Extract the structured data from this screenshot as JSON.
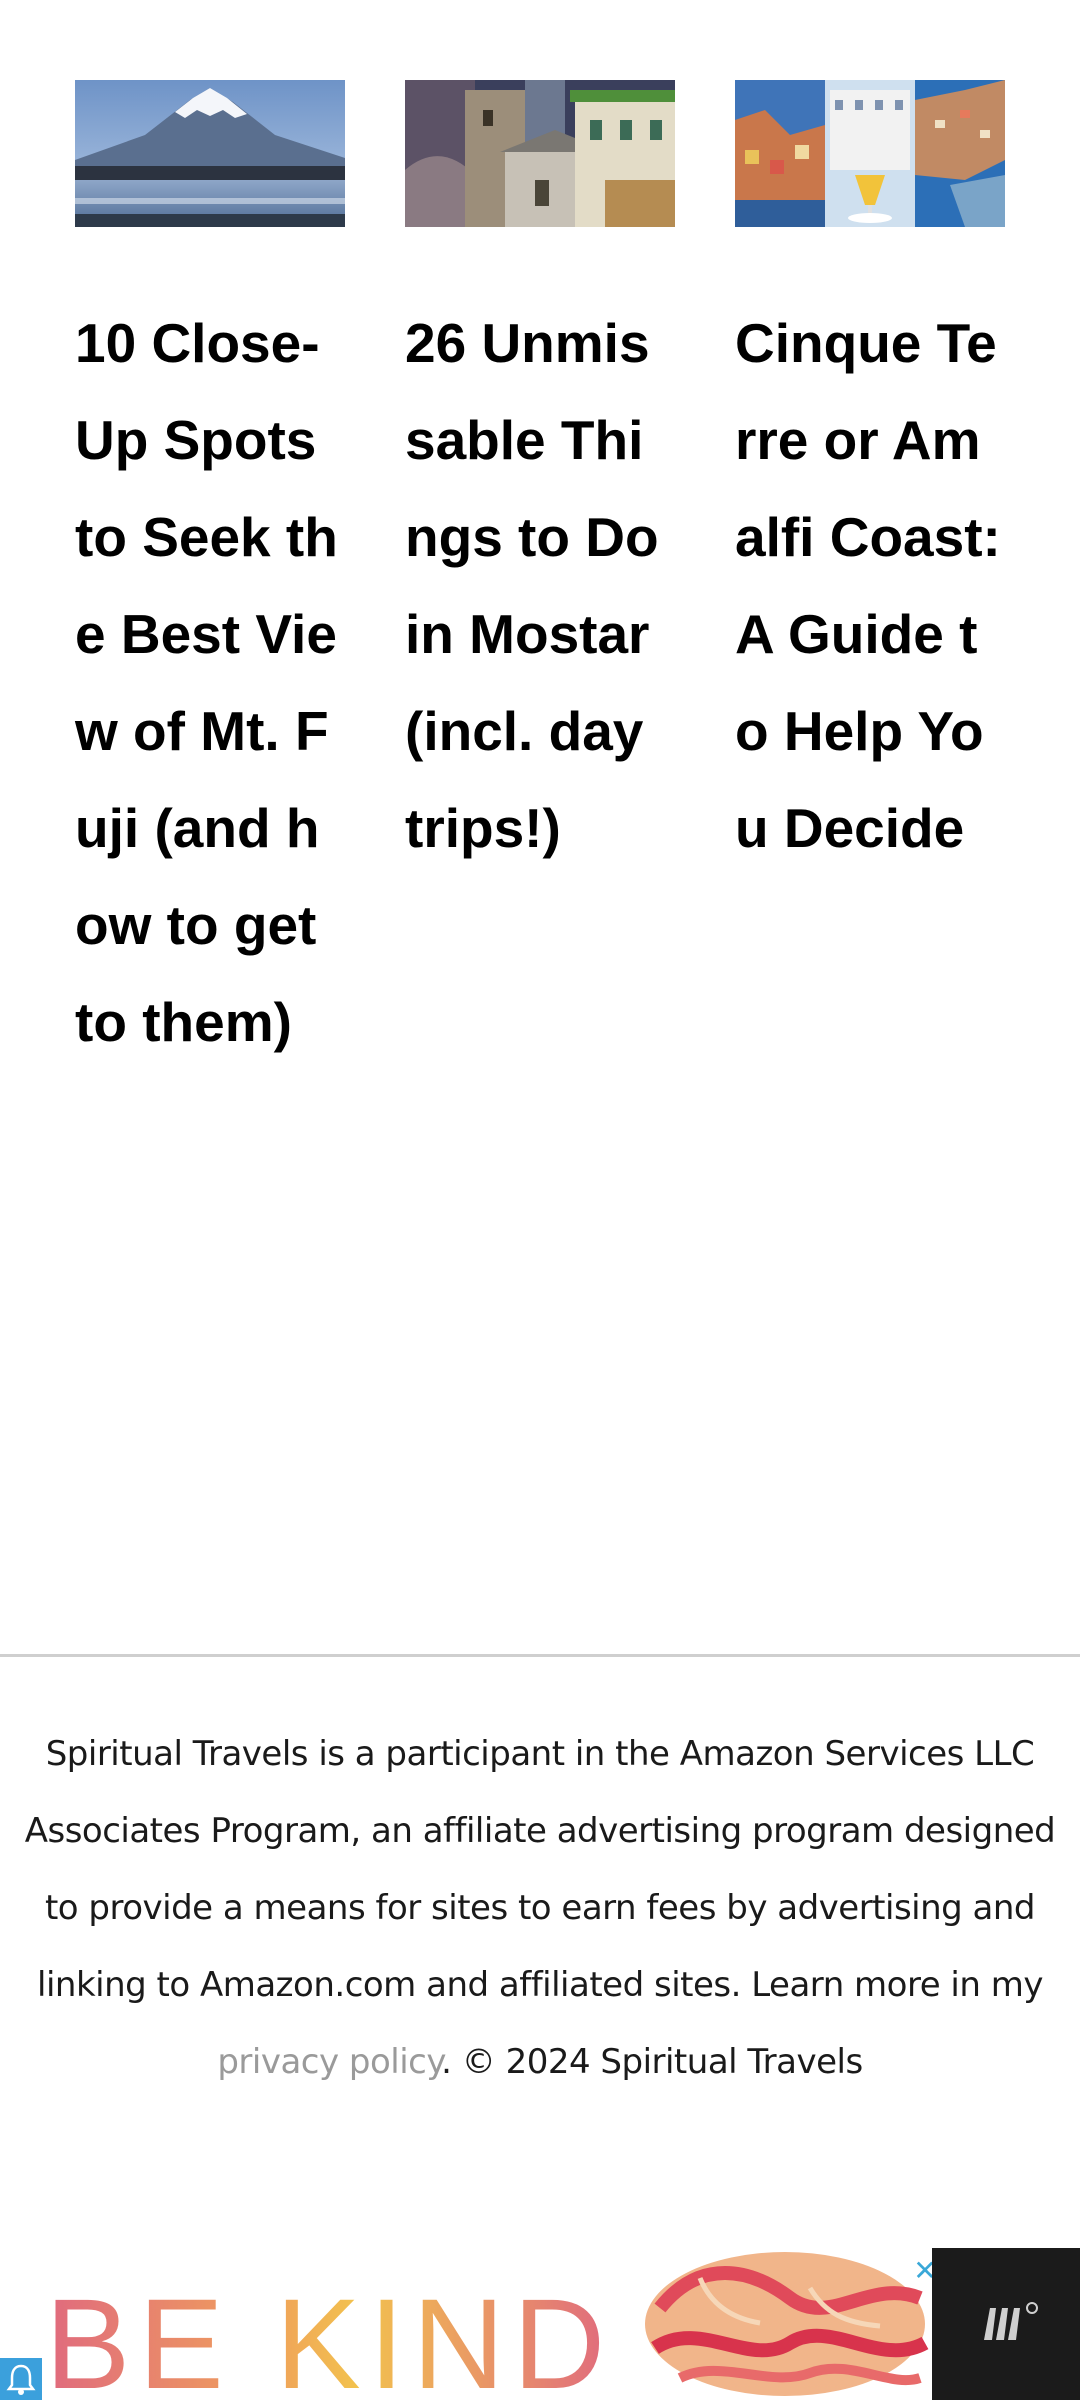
{
  "related_posts": [
    {
      "title": "10 Close-Up Spots to Seek the Best View of Mt. Fuji (and how to get to them)",
      "image": "mt-fuji-lake-photo"
    },
    {
      "title": "26 Unmissable Things to Do in Mostar (incl. day trips!)",
      "image": "mostar-old-town-photo"
    },
    {
      "title": "Cinque Terre or Amalfi Coast: A Guide to Help You Decide",
      "image": "cinque-terre-amalfi-collage"
    }
  ],
  "footer": {
    "text_before_link": "Spiritual Travels is a participant in the Amazon Services LLC Associates Program, an affiliate advertising program designed to provide a means for sites to earn fees by advertising and linking to Amazon.com and affiliated sites. Learn more in my ",
    "link_text": "privacy policy",
    "text_after_link": ". © 2024 Spiritual Travels"
  },
  "ad": {
    "headline": "BE KIND",
    "close_icon": "close-icon",
    "brand_icon": "ad-brand-logo-icon"
  },
  "colors": {
    "link": "#9a9a9a",
    "divider": "#cfcfcf",
    "ad_dark": "#1b1b1b",
    "bell_bg": "#3ba0dc"
  }
}
